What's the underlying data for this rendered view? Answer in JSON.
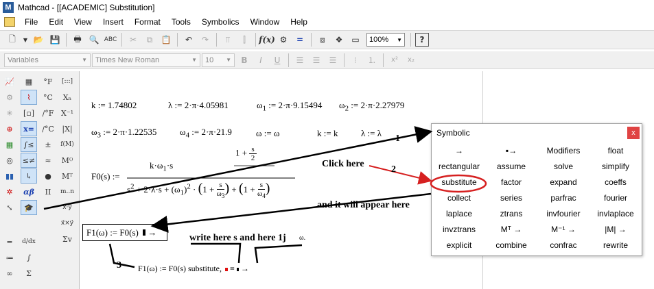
{
  "window": {
    "title": "Mathcad - [[ACADEMIC] Substitution]",
    "app_icon": "M"
  },
  "menu": [
    "File",
    "Edit",
    "View",
    "Insert",
    "Format",
    "Tools",
    "Symbolics",
    "Window",
    "Help"
  ],
  "toolbar": {
    "zoom_value": "100%",
    "icons": [
      "new-icon",
      "open-icon",
      "save-icon",
      "print-icon",
      "print-preview-icon",
      "spell-check-icon",
      "cut-icon",
      "copy-icon",
      "paste-icon",
      "undo-icon",
      "redo-icon",
      "align-icon",
      "insert-function-icon",
      "insert-unit-icon",
      "calculate-icon",
      "component-icon",
      "resource-icon",
      "help-icon"
    ]
  },
  "formatbar": {
    "style_value": "Variables",
    "font_value": "Times New Roman",
    "size_value": "10",
    "bold_label": "B",
    "italic_label": "I",
    "underline_label": "U"
  },
  "palettes": {
    "col1": [
      "graph-icon",
      "matrix-icon",
      "calculus-icon",
      "boolean-icon",
      "programming-icon",
      "greek-icon",
      "symbolic-icon",
      "units-icon",
      "modifiers-icon",
      "custom-icon",
      "window-icon"
    ],
    "greek_label": "αβ",
    "col2_symbols": [
      "°F",
      "°C",
      "/°F",
      "/°C",
      "±",
      "≈",
      "●",
      "II"
    ],
    "col3_symbols": [
      "[:::]",
      "Xₙ",
      "X⁻¹",
      "|X|",
      "f(M)",
      "M⁽⁾",
      "Mᵀ",
      "m..n",
      "x⃗·y⃗",
      "x⃗×y⃗",
      "Σv"
    ],
    "bottom_symbols": [
      "=",
      "≔",
      "∞",
      "d/dx",
      "∫",
      "Σ"
    ]
  },
  "worksheet": {
    "k_def": "k := 1.74802",
    "lambda_def": "λ := 2·π·4.05981",
    "omega1_def": "2·π·9.15494",
    "omega2_def": "2·π·2.27979",
    "omega3_def": "2·π·1.22535",
    "omega4_def": "2·π·21.9",
    "omega_eq": "ω := ω",
    "k_eq": "k := k",
    "lambda_eq": "λ := λ",
    "f0_lhs": "F0(s) :=",
    "f1_expr": "F1(ω) := F0(s)",
    "f1_result": "F1(ω) := F0(s) substitute,",
    "arrow": "→"
  },
  "annotations": {
    "num1": "1",
    "num2": "2",
    "num3": "3",
    "click_here": "Click here",
    "appear_here": "and it will appear here",
    "write_here": "write here s and here 1j",
    "omega_hint": "ω."
  },
  "symbolic_palette": {
    "title": "Symbolic",
    "close_label": "x",
    "cells": [
      "→",
      "▪→",
      "Modifiers",
      "float",
      "rectangular",
      "assume",
      "solve",
      "simplify",
      "substitute",
      "factor",
      "expand",
      "coeffs",
      "collect",
      "series",
      "parfrac",
      "fourier",
      "laplace",
      "ztrans",
      "invfourier",
      "invlaplace",
      "invztrans",
      "Mᵀ →",
      "M⁻¹ →",
      "|M| →",
      "explicit",
      "combine",
      "confrac",
      "rewrite"
    ]
  },
  "colors": {
    "highlight_ring": "#d62020",
    "palette_close": "#e04343",
    "cursor_red": "#e01010"
  }
}
